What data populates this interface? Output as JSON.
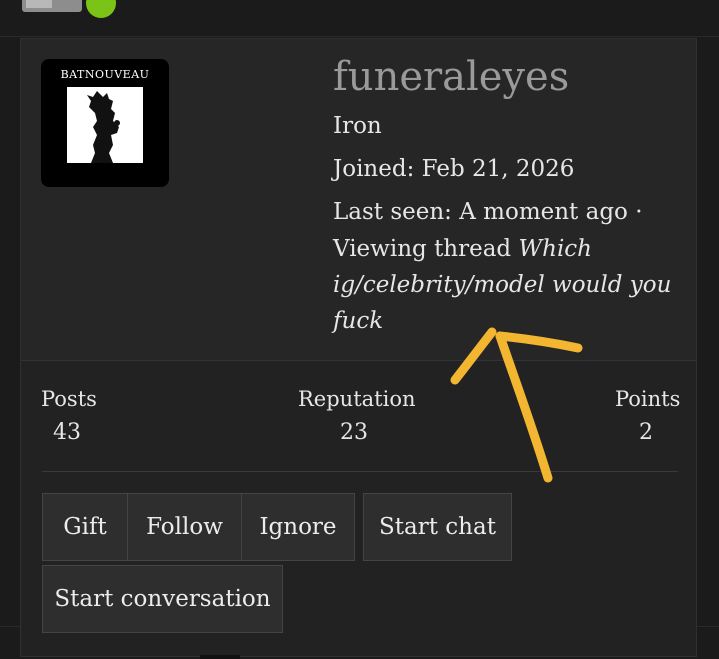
{
  "profile": {
    "avatar_text": "BATNOUVEAU",
    "username": "funeraleyes",
    "rank": "Iron",
    "joined_label": "Joined:",
    "joined_value": "Feb 21, 2026",
    "last_seen_label": "Last seen:",
    "last_seen_value": "A moment ago",
    "separator": "·",
    "activity_prefix": "Viewing thread",
    "activity_thread": "Which ig/celebrity/model would you fuck"
  },
  "stats": {
    "posts_label": "Posts",
    "posts_value": "43",
    "reputation_label": "Reputation",
    "reputation_value": "23",
    "points_label": "Points",
    "points_value": "2"
  },
  "actions": {
    "gift": "Gift",
    "follow": "Follow",
    "ignore": "Ignore",
    "start_chat": "Start chat",
    "start_conversation": "Start conversation"
  },
  "colors": {
    "online": "#7cc318",
    "annotation_arrow": "#f2b630",
    "username": "#9a9a9a"
  }
}
